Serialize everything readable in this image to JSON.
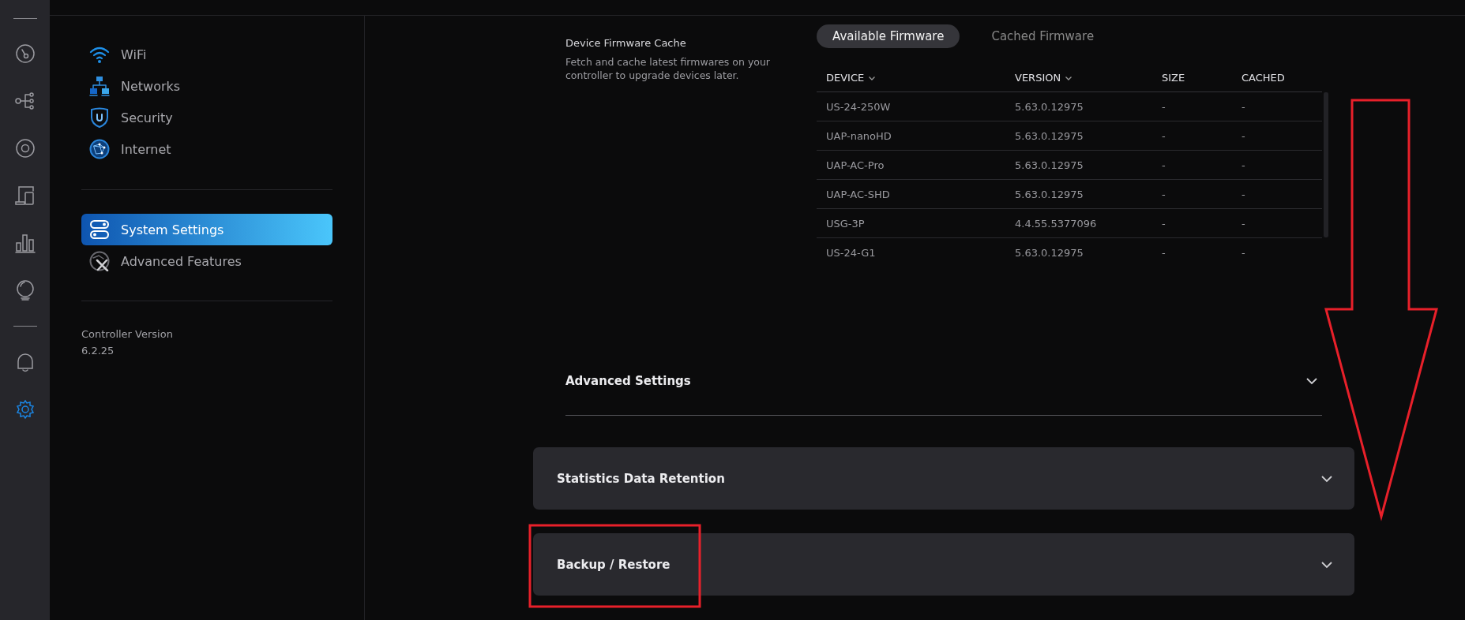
{
  "rail": {
    "top": [
      {
        "kind": "dashboard",
        "selected": false
      },
      {
        "kind": "topology",
        "selected": false
      },
      {
        "kind": "devices",
        "selected": false
      },
      {
        "kind": "clients",
        "selected": false
      },
      {
        "kind": "statistics",
        "selected": false
      },
      {
        "kind": "insights",
        "selected": false
      }
    ],
    "bottom": [
      {
        "kind": "alerts",
        "selected": false
      },
      {
        "kind": "settings",
        "selected": true
      }
    ]
  },
  "sidebar": {
    "groups": [
      [
        {
          "kind": "wifi",
          "label": "WiFi",
          "selected": false
        },
        {
          "kind": "networks",
          "label": "Networks",
          "selected": false
        },
        {
          "kind": "security",
          "label": "Security",
          "selected": false
        },
        {
          "kind": "internet",
          "label": "Internet",
          "selected": false
        }
      ],
      [
        {
          "kind": "system",
          "label": "System Settings",
          "selected": true
        },
        {
          "kind": "advanced",
          "label": "Advanced Features",
          "selected": false
        }
      ]
    ],
    "footer": {
      "label": "Controller Version",
      "value": "6.2.25"
    }
  },
  "firmware": {
    "title": "Device Firmware Cache",
    "description": "Fetch and cache latest firmwares on your controller to upgrade devices later.",
    "tabs": [
      {
        "label": "Available Firmware",
        "selected": true
      },
      {
        "label": "Cached Firmware",
        "selected": false
      }
    ],
    "table": {
      "columns": [
        {
          "label": "DEVICE",
          "sortable": true
        },
        {
          "label": "VERSION",
          "sortable": true
        },
        {
          "label": "SIZE",
          "sortable": false
        },
        {
          "label": "CACHED",
          "sortable": false
        }
      ],
      "rows": [
        [
          "US-24-250W",
          "5.63.0.12975",
          "-",
          "-"
        ],
        [
          "UAP-nanoHD",
          "5.63.0.12975",
          "-",
          "-"
        ],
        [
          "UAP-AC-Pro",
          "5.63.0.12975",
          "-",
          "-"
        ],
        [
          "UAP-AC-SHD",
          "5.63.0.12975",
          "-",
          "-"
        ],
        [
          "USG-3P",
          "4.4.55.5377096",
          "-",
          "-"
        ],
        [
          "US-24-G1",
          "5.63.0.12975",
          "-",
          "-"
        ]
      ]
    }
  },
  "sections": [
    {
      "kind": "flat",
      "title": "Advanced Settings",
      "expanded": false
    },
    {
      "kind": "card",
      "title": "Statistics Data Retention",
      "expanded": false
    },
    {
      "kind": "card",
      "title": "Backup / Restore",
      "expanded": false
    }
  ]
}
